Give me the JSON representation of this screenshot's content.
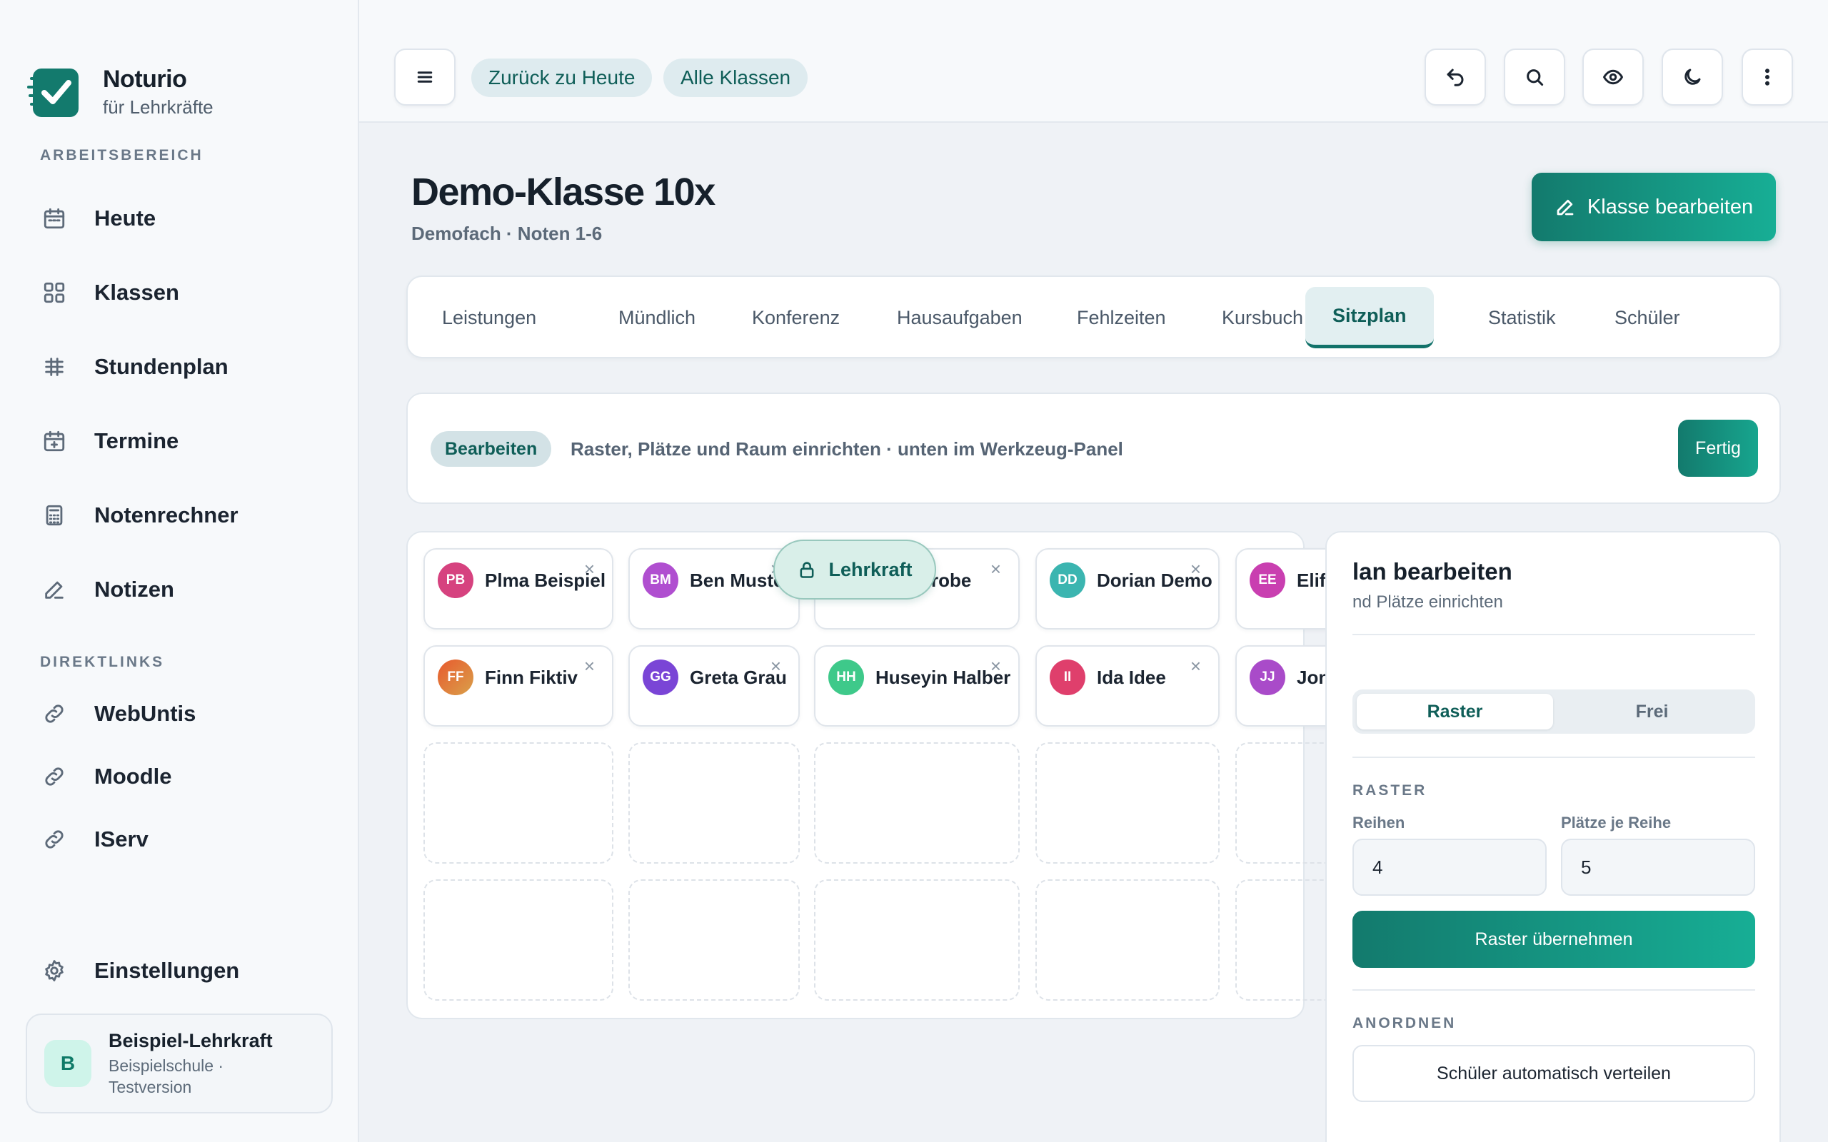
{
  "brand": {
    "name": "Noturio",
    "subtitle": "für Lehrkräfte"
  },
  "sidebar": {
    "section_work": "ARBEITSBEREICH",
    "items": [
      {
        "label": "Heute",
        "icon": "calendar-icon"
      },
      {
        "label": "Klassen",
        "icon": "grid-icon"
      },
      {
        "label": "Stundenplan",
        "icon": "timetable-icon"
      },
      {
        "label": "Termine",
        "icon": "calendar-plus-icon"
      },
      {
        "label": "Notenrechner",
        "icon": "calculator-icon"
      },
      {
        "label": "Notizen",
        "icon": "pencil-icon"
      }
    ],
    "section_links": "DIREKTLINKS",
    "links": [
      {
        "label": "WebUntis",
        "icon": "link-icon"
      },
      {
        "label": "Moodle",
        "icon": "link-icon"
      },
      {
        "label": "IServ",
        "icon": "link-icon"
      }
    ],
    "settings": "Einstellungen",
    "user": {
      "initial": "B",
      "name": "Beispiel-Lehrkraft",
      "school": "Beispielschule · Testversion"
    }
  },
  "topbar": {
    "pill_today": "Zurück zu Heute",
    "pill_classes": "Alle Klassen",
    "icons": [
      "menu-icon",
      "undo-icon",
      "search-icon",
      "eye-icon",
      "moon-icon",
      "more-vertical-icon"
    ]
  },
  "page": {
    "title": "Demo-Klasse 10x",
    "subtitle": "Demofach · Noten 1-6",
    "edit_button": "Klasse bearbeiten"
  },
  "tabs": [
    {
      "label": "Leistungen"
    },
    {
      "label": "Mündlich"
    },
    {
      "label": "Konferenz"
    },
    {
      "label": "Hausaufgaben"
    },
    {
      "label": "Fehlzeiten"
    },
    {
      "label": "Kursbuch"
    },
    {
      "label": "Sitzplan",
      "active": true
    },
    {
      "label": "Statistik"
    },
    {
      "label": "Schüler"
    }
  ],
  "edit_bar": {
    "badge": "Bearbeiten",
    "hint": "Raster, Plätze und Raum einrichten · unten im Werkzeug-Panel",
    "done": "Fertig"
  },
  "seats": {
    "teacher_label": "Lehrkraft",
    "remove_symbol": "×",
    "row1": [
      {
        "initials": "PB",
        "name": "Plma Beispiel",
        "color": "#d6427f"
      },
      {
        "initials": "BM",
        "name": "Ben Muste",
        "color": "#b04fd0"
      },
      {
        "initials": "",
        "name": "robe",
        "color": "#ffffff"
      },
      {
        "initials": "DD",
        "name": "Dorian Demo",
        "color": "#3bb5b0"
      },
      {
        "initials": "EE",
        "name": "Elif Exempel",
        "color": "#c93fb0"
      }
    ],
    "row2": [
      {
        "initials": "FF",
        "name": "Finn Fiktiv",
        "color": "#e46a3c"
      },
      {
        "initials": "GG",
        "name": "Greta Grau",
        "color": "#7a45d6"
      },
      {
        "initials": "HH",
        "name": "Huseyin Halber",
        "color": "#3ec98a"
      },
      {
        "initials": "II",
        "name": "Ida Idee",
        "color": "#df3f6c"
      },
      {
        "initials": "JJ",
        "name": "Jonas Jux",
        "color": "#a94bc9"
      }
    ]
  },
  "panel": {
    "title": "lan bearbeiten",
    "subtitle": "nd Plätze einrichten",
    "mode_grid": "Raster",
    "mode_free": "Frei",
    "section_grid": "RASTER",
    "rows_label": "Reihen",
    "rows_value": "4",
    "seats_label": "Plätze je Reihe",
    "seats_value": "5",
    "apply": "Raster übernehmen",
    "section_arrange": "ANORDNEN",
    "auto": "Schüler automatisch verteilen"
  },
  "colors": {
    "accent": "#137a6d",
    "accent_light": "#17ae95",
    "pill_bg": "#deebef"
  }
}
